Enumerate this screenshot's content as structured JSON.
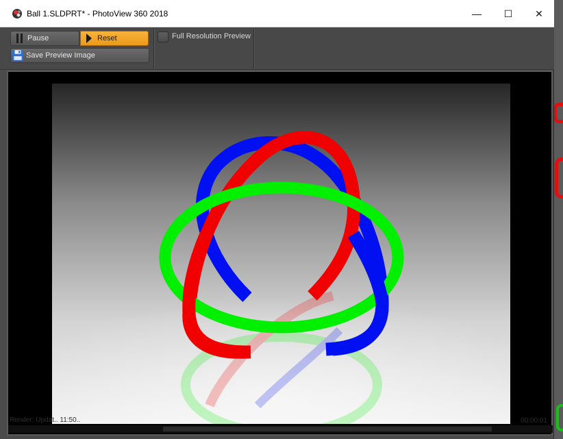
{
  "window": {
    "title": "Ball 1.SLDPRT* - PhotoView 360 2018",
    "minimize_glyph": "—",
    "maximize_glyph": "☐",
    "close_glyph": "✕"
  },
  "toolbar": {
    "pause_label": "Pause",
    "reset_label": "Reset",
    "save_label": "Save Preview Image",
    "full_res_label": "Full Resolution Preview",
    "full_res_checked": false
  },
  "status": {
    "left_text": "Render: Updat.. 11:50..",
    "right_text": "00:00:01"
  },
  "render": {
    "ring_colors": {
      "red": "#f00000",
      "green": "#00f000",
      "blue": "#0010f0"
    }
  },
  "icons": {
    "app": "photoview-app-icon",
    "pause": "pause-icon",
    "reset": "play-triangle-icon",
    "save": "floppy-disk-icon"
  },
  "colors": {
    "accent": "#f0a020",
    "toolbar_bg": "#484848",
    "viewport_bg": "#000000"
  }
}
